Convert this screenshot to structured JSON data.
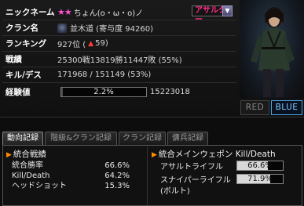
{
  "profile": {
    "nickname": {
      "label": "ニックネーム",
      "value": "ちょん(o・ω・o)ノ"
    },
    "class_select": {
      "value": "アサルター"
    },
    "clan": {
      "label": "クラン名",
      "value": "並木道 (寄与度 94260)"
    },
    "ranking": {
      "label": "ランキング",
      "rank": "927位 (",
      "change": "59",
      "suffix": ")"
    },
    "record": {
      "label": "戦績",
      "value": "25300戦13819勝11447敗 (55%)"
    },
    "kd": {
      "label": "キル/デス",
      "value": "171968 / 151149 (53%)"
    },
    "exp": {
      "label": "経験値",
      "percent_text": "2.2%",
      "progress": 0.022,
      "total": "15223018"
    }
  },
  "teams": {
    "red": "RED",
    "blue": "BLUE"
  },
  "tabs": [
    {
      "label": "動向記録"
    },
    {
      "label": "階級&クラン記録"
    },
    {
      "label": "クラン記録"
    },
    {
      "label": "傭兵記録"
    }
  ],
  "summary": {
    "title": "統合戦績",
    "rows": [
      {
        "name": "統合勝率",
        "value": "66.6%"
      },
      {
        "name": "Kill/Death",
        "value": "64.2%"
      },
      {
        "name": "ヘッドショット",
        "value": "15.3%"
      }
    ]
  },
  "weapons": {
    "title": "統合メインウェポン Kill/Death",
    "rows": [
      {
        "name": "アサルトライフル",
        "value": "66.6%",
        "progress": 0.666
      },
      {
        "name": "スナイパーライフル",
        "value": "71.9%",
        "progress": 0.719,
        "sub": "(ボルト)"
      }
    ]
  },
  "colors": {
    "accent_pink": "#ff2d8a",
    "blue_team": "#4aa8e8",
    "down_red": "#ff3a3a",
    "heading_triangle": "#ff8a00"
  },
  "icons": {
    "rank_change": "down-arrow-icon",
    "clan": "clan-emblem-icon",
    "dropdown": "chevron-down-icon",
    "stars": "star-icon"
  }
}
